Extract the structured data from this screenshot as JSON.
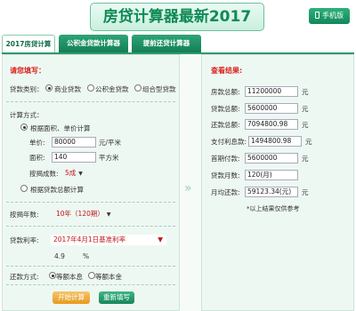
{
  "header": {
    "title": "房贷计算器最新2017",
    "mobile_label": "手机版"
  },
  "tabs": [
    {
      "label": "2017房贷计算器"
    },
    {
      "label": "公积金贷款计算器"
    },
    {
      "label": "提前还贷计算器"
    }
  ],
  "form": {
    "section_title": "请您填写：",
    "loan_type": {
      "label": "贷款类别：",
      "options": [
        "商业贷款",
        "公积金贷款",
        "组合型贷款"
      ]
    },
    "calc_method": {
      "label": "计算方式：",
      "option_area": "根据面积、单价计算",
      "unit_price": {
        "label": "单价:",
        "value": "80000",
        "unit": "元/平米"
      },
      "area": {
        "label": "面积:",
        "value": "140",
        "unit": "平方米"
      },
      "down_payment": {
        "label": "按揭成数:",
        "value": "5成"
      },
      "option_total": "根据贷款总额计算"
    },
    "term": {
      "label": "按揭年数:",
      "value": "10年（120期）"
    },
    "rate": {
      "label": "贷款利率:",
      "value": "2017年4月1日基准利率",
      "rate_value": "4.9",
      "percent": "%"
    },
    "repay": {
      "label": "还款方式:",
      "options": [
        "等额本息",
        "等额本金"
      ]
    },
    "calc_button": "开始计算",
    "reset_button": "重新填写"
  },
  "results": {
    "title": "查看结果:",
    "rows": [
      {
        "label": "房款总额:",
        "value": "11200000",
        "unit": "元"
      },
      {
        "label": "贷款总额:",
        "value": "5600000",
        "unit": "元"
      },
      {
        "label": "还款总额:",
        "value": "7094800.98",
        "unit": "元"
      },
      {
        "label": "支付利息款:",
        "value": "1494800.98",
        "unit": "元"
      },
      {
        "label": "首期付款:",
        "value": "5600000",
        "unit": "元"
      },
      {
        "label": "贷款月数:",
        "value": "120(月)",
        "unit": ""
      },
      {
        "label": "月均还款:",
        "value": "59123.34(元)",
        "unit": "元"
      }
    ],
    "note": "*以上结果仅供参考"
  },
  "colors": {
    "brand_green": "#0f8a54",
    "accent_red": "#d9261c",
    "button_orange": "#e69a1e"
  }
}
